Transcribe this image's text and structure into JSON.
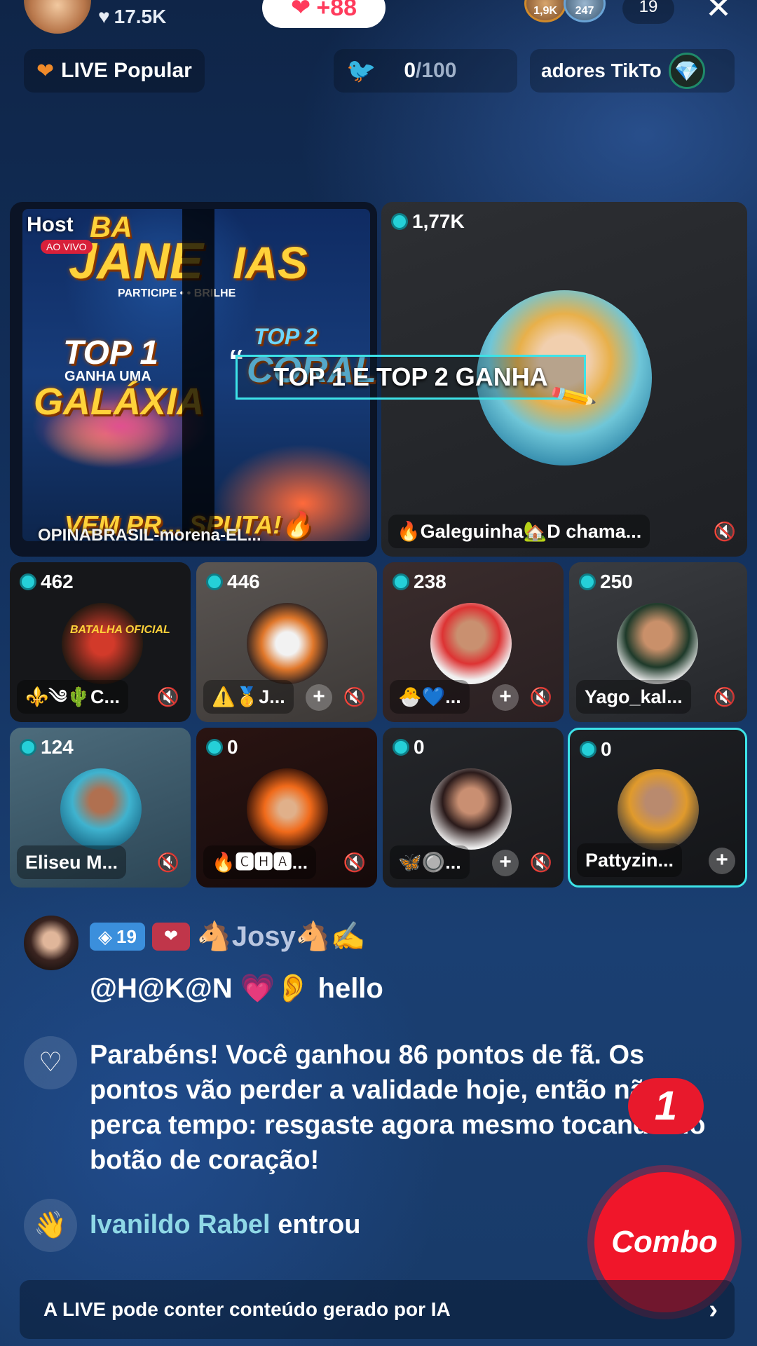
{
  "top_bar": {
    "likes": "17.5K",
    "heart_plus": "+88",
    "viewer_badges": [
      "1,9K",
      "247"
    ],
    "viewer_count": "19",
    "close_icon": "close-icon"
  },
  "chips": {
    "live_popular": "LIVE Popular",
    "goal_progress": "0",
    "goal_total": "/100",
    "ranking_text": "adores TikTo"
  },
  "grid": {
    "host": {
      "label": "Host",
      "ao_vivo": "AO VIVO",
      "poster_top": "BA",
      "poster_title": "JANE",
      "poster_title_2": "IAS",
      "poster_tagline": "PARTICIPE • • BRILHE",
      "poster_top1": "TOP 1",
      "poster_ganha": "GANHA UMA",
      "poster_galaxia": "GALÁXIA",
      "poster_coral": "CORAL",
      "poster_top2": "TOP 2",
      "poster_bottom": "VEM PR... SPUTA!🔥",
      "name": "OPINABRASIL-morena-EL..."
    },
    "tiles": [
      {
        "score": "1,77K",
        "name": "🔥Galeguinha🏡D chama...",
        "mute": true,
        "plus": false
      },
      {
        "score": "462",
        "name": "⚜️༄🌵C...",
        "mute": true,
        "plus": false
      },
      {
        "score": "446",
        "name": "⚠️🥇J...",
        "mute": true,
        "plus": true
      },
      {
        "score": "238",
        "name": "🐣💙...",
        "mute": true,
        "plus": true
      },
      {
        "score": "250",
        "name": "Yago_kal...",
        "mute": true,
        "plus": false
      },
      {
        "score": "124",
        "name": "Eliseu M...",
        "mute": true,
        "plus": false
      },
      {
        "score": "0",
        "name": "🔥🅲🅷🅰...",
        "mute": true,
        "plus": false
      },
      {
        "score": "0",
        "name": "🦋🔘...",
        "mute": true,
        "plus": true
      },
      {
        "score": "0",
        "name": "Pattyzin...",
        "mute": false,
        "plus": true
      }
    ],
    "overlay_banner": "TOP 1 E TOP 2 GANHA",
    "tile_4_poster": "BATALHA OFICIAL"
  },
  "chat": {
    "user_level": "19",
    "user_name": "🐴Josy🐴✍️",
    "message": "@H@K@N 💗👂 hello",
    "fan_points_message": "Parabéns! Você ganhou 86 pontos de fã. Os pontos vão perder a validade hoje, então não perca tempo: resgaste agora mesmo tocando no botão de coração!",
    "join_user": "Ivanildo Rabel",
    "join_action": "entrou"
  },
  "combo": {
    "count": "1",
    "label": "Combo"
  },
  "footer": {
    "ai_notice": "A LIVE pode conter conteúdo gerado por IA"
  },
  "colors": {
    "accent_cyan": "#3de3e8",
    "combo_red": "#f0162a",
    "coin": "#25d0d8"
  }
}
